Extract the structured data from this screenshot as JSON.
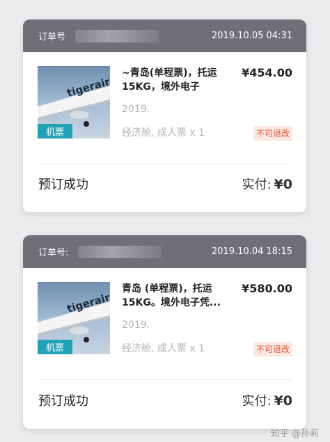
{
  "orders": [
    {
      "order_no_label": "订单号",
      "datetime": "2019.10.05 04:31",
      "badge": "机票",
      "title": "~青岛(单程票)，托运15KG，境外电子",
      "price": "¥454.00",
      "date": "2019.",
      "class_info": "经济舱, 成人票 x 1",
      "nonrefundable": "不可退改",
      "status": "预订成功",
      "paid_label": "实付:",
      "paid_amount": "¥0"
    },
    {
      "order_no_label": "订单号:",
      "datetime": "2019.10.04 18:15",
      "badge": "机票",
      "title": "青岛 (单程票)，托运15KG。境外电子凭...",
      "price": "¥580.00",
      "date": "2019.",
      "class_info": "经济舱, 成人票 x 1",
      "nonrefundable": "不可退改",
      "status": "预订成功",
      "paid_label": "实付:",
      "paid_amount": "¥0"
    }
  ],
  "thumb_brand_text": "tigerair",
  "watermark": "知乎 @孙莉",
  "colors": {
    "header_bg": "#6f6f7b",
    "badge_bg": "#21a3b6",
    "nonref_text": "#e05a3a",
    "nonref_bg": "#fbe8e3"
  }
}
